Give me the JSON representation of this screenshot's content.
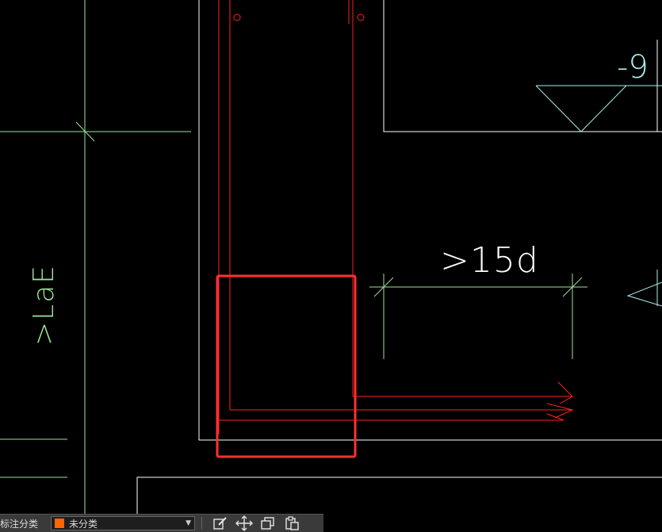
{
  "drawing": {
    "annotations": {
      "lae_label": ">LaE",
      "fifteen_d_label": ">15d",
      "elevation_label": "-9"
    },
    "colors": {
      "background": "#000000",
      "outline": "#ffffff",
      "rebar": "#ff2020",
      "dimension": "#9be39b",
      "highlight": "#ff3030",
      "elevation": "#a8f0f0"
    }
  },
  "toolbar": {
    "category_label": "标注分类",
    "category_select": {
      "value": "未分类",
      "swatch_color": "#ff6600"
    },
    "buttons": [
      {
        "name": "edit-icon"
      },
      {
        "name": "move-icon"
      },
      {
        "name": "copy-icon"
      },
      {
        "name": "paste-icon"
      }
    ]
  }
}
